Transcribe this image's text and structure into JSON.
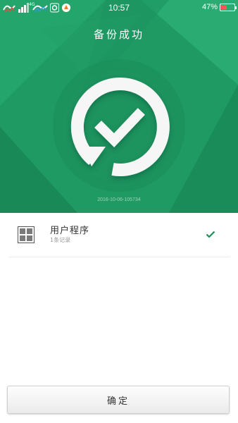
{
  "status_bar": {
    "signal": "4G",
    "time": "10:57",
    "battery_percent": "47%",
    "battery_level": 0.47,
    "icons": [
      "app-notification-icon",
      "app-notification-icon",
      "signal-icon",
      "sync-icon",
      "app-icon"
    ]
  },
  "header": {
    "title": "备份成功"
  },
  "backup": {
    "timestamp": "2016-10-06-105734"
  },
  "items": [
    {
      "title": "用户程序",
      "subtitle": "1条记录",
      "icon": "app-grid-icon",
      "checked": true
    }
  ],
  "footer": {
    "confirm_label": "确定"
  },
  "colors": {
    "primary_green": "#1f9a63",
    "check_green": "#1a8f57",
    "background": "#ffffff"
  }
}
